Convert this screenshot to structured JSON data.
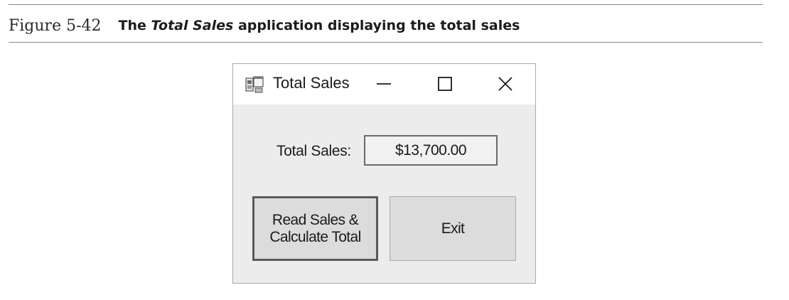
{
  "figure": {
    "number": "Figure 5-42",
    "title_prefix": "The",
    "title_emphasis": "Total Sales",
    "title_suffix": "application displaying the total sales"
  },
  "window": {
    "title": "Total Sales",
    "controls": {
      "minimize_icon": "minimize-icon",
      "maximize_icon": "maximize-icon",
      "close_icon": "close-icon"
    }
  },
  "form": {
    "total_label": "Total Sales:",
    "total_value": "$13,700.00"
  },
  "buttons": {
    "calculate_label": "Read Sales &\nCalculate Total",
    "exit_label": "Exit"
  },
  "colors": {
    "titlebar": "#ffffff",
    "client_area": "#ececec",
    "button_face": "#dcdcdc"
  }
}
